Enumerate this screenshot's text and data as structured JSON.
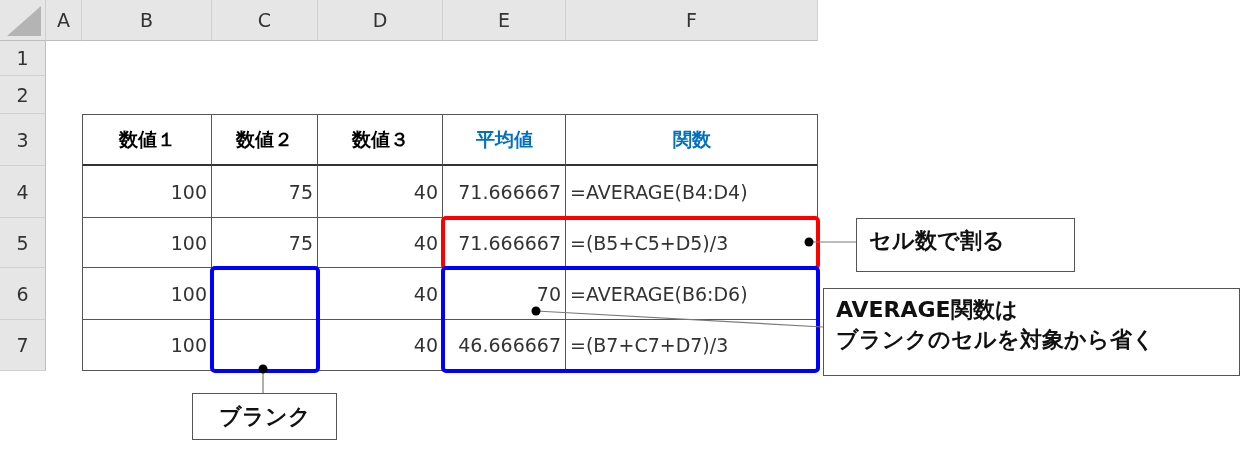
{
  "column_headers": [
    "A",
    "B",
    "C",
    "D",
    "E",
    "F"
  ],
  "row_headers": [
    "1",
    "2",
    "3",
    "4",
    "5",
    "6",
    "7"
  ],
  "table": {
    "header": [
      {
        "text": "数値１",
        "color": "#000000"
      },
      {
        "text": "数値２",
        "color": "#000000"
      },
      {
        "text": "数値３",
        "color": "#000000"
      },
      {
        "text": "平均値",
        "color": "#0070c0"
      },
      {
        "text": "関数",
        "color": "#0070c0"
      }
    ],
    "rows": [
      {
        "cells": [
          "100",
          "75",
          "40",
          "71.666667",
          "=AVERAGE(B4:D4)"
        ]
      },
      {
        "cells": [
          "100",
          "75",
          "40",
          "71.666667",
          "=(B5+C5+D5)/3"
        ]
      },
      {
        "cells": [
          "100",
          null,
          "40",
          "70",
          "=AVERAGE(B6:D6)"
        ]
      },
      {
        "cells": [
          "100",
          null,
          "40",
          "46.666667",
          "=(B7+C7+D7)/3"
        ]
      }
    ]
  },
  "highlights": [
    {
      "color": "#ff0000"
    },
    {
      "color": "#0000ff"
    },
    {
      "color": "#0000ff"
    }
  ],
  "callouts": [
    {
      "lines": [
        "セル数で割る"
      ]
    },
    {
      "lines": [
        "AVERAGE関数は",
        "ブランクのセルを対象から省く"
      ]
    },
    {
      "lines": [
        "ブランク"
      ]
    }
  ]
}
